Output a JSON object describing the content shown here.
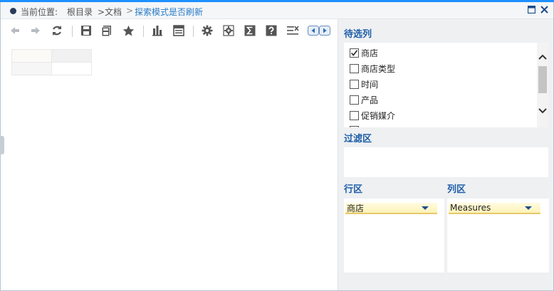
{
  "breadcrumb": {
    "prefix": "当前位置:",
    "items": [
      "根目录",
      ">文档",
      ">",
      "探索模式是否刷新"
    ]
  },
  "toolbar": {
    "icons": [
      "back-arrow-icon",
      "forward-arrow-icon",
      "refresh-icon",
      "save-icon",
      "save-as-icon",
      "favorite-star-icon",
      "bar-chart-icon",
      "table-view-icon",
      "settings-gear-icon",
      "advanced-settings-icon",
      "sum-icon",
      "help-icon",
      "clear-filter-icon",
      "scroll-left-icon",
      "scroll-right-icon"
    ]
  },
  "candidate_panel": {
    "title": "待选列",
    "items": [
      {
        "label": "商店",
        "checked": true
      },
      {
        "label": "商店类型",
        "checked": false
      },
      {
        "label": "时间",
        "checked": false
      },
      {
        "label": "产品",
        "checked": false
      },
      {
        "label": "促销媒介",
        "checked": false
      }
    ]
  },
  "filter_panel": {
    "title": "过滤区"
  },
  "row_zone": {
    "title": "行区",
    "field": "商店"
  },
  "col_zone": {
    "title": "列区",
    "field": "Measures"
  },
  "colors": {
    "accent": "#1e90ff",
    "section_title": "#1f5ea8",
    "breadcrumb_current": "#2b7cc6",
    "field_highlight": "#fff3b8"
  }
}
